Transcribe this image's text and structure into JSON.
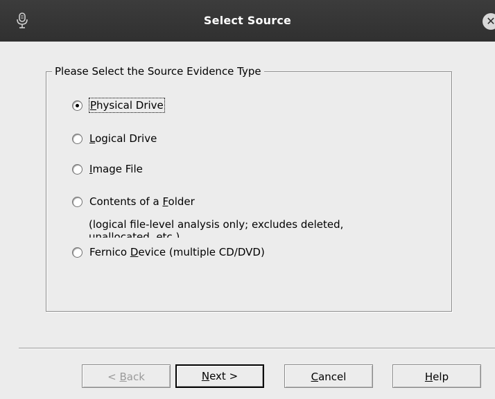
{
  "window": {
    "title": "Select Source",
    "close_glyph": "✕"
  },
  "group": {
    "legend": "Please Select the Source Evidence Type"
  },
  "options": [
    {
      "pre": "",
      "mnemonic": "P",
      "post": "hysical Drive",
      "checked": true
    },
    {
      "pre": "",
      "mnemonic": "L",
      "post": "ogical Drive",
      "checked": false
    },
    {
      "pre": "",
      "mnemonic": "I",
      "post": "mage File",
      "checked": false
    },
    {
      "pre": "Contents of a ",
      "mnemonic": "F",
      "post": "older",
      "checked": false
    },
    {
      "pre": "Fernico ",
      "mnemonic": "D",
      "post": "evice (multiple CD/DVD)",
      "checked": false
    }
  ],
  "folder_description": "(logical file-level analysis only; excludes deleted, unallocated, etc.)",
  "buttons": {
    "back": {
      "pre": "< ",
      "mnemonic": "B",
      "post": "ack",
      "enabled": false
    },
    "next": {
      "pre": "",
      "mnemonic": "N",
      "post": "ext >",
      "enabled": true
    },
    "cancel": {
      "pre": "",
      "mnemonic": "C",
      "post": "ancel",
      "enabled": true
    },
    "help": {
      "pre": "",
      "mnemonic": "H",
      "post": "elp",
      "enabled": true
    }
  },
  "icons": {
    "app": "microphone-icon",
    "close": "close-icon"
  },
  "colors": {
    "titlebar": "#333333",
    "dialog_bg": "#ececec",
    "disabled_text": "#9a9a9a"
  }
}
